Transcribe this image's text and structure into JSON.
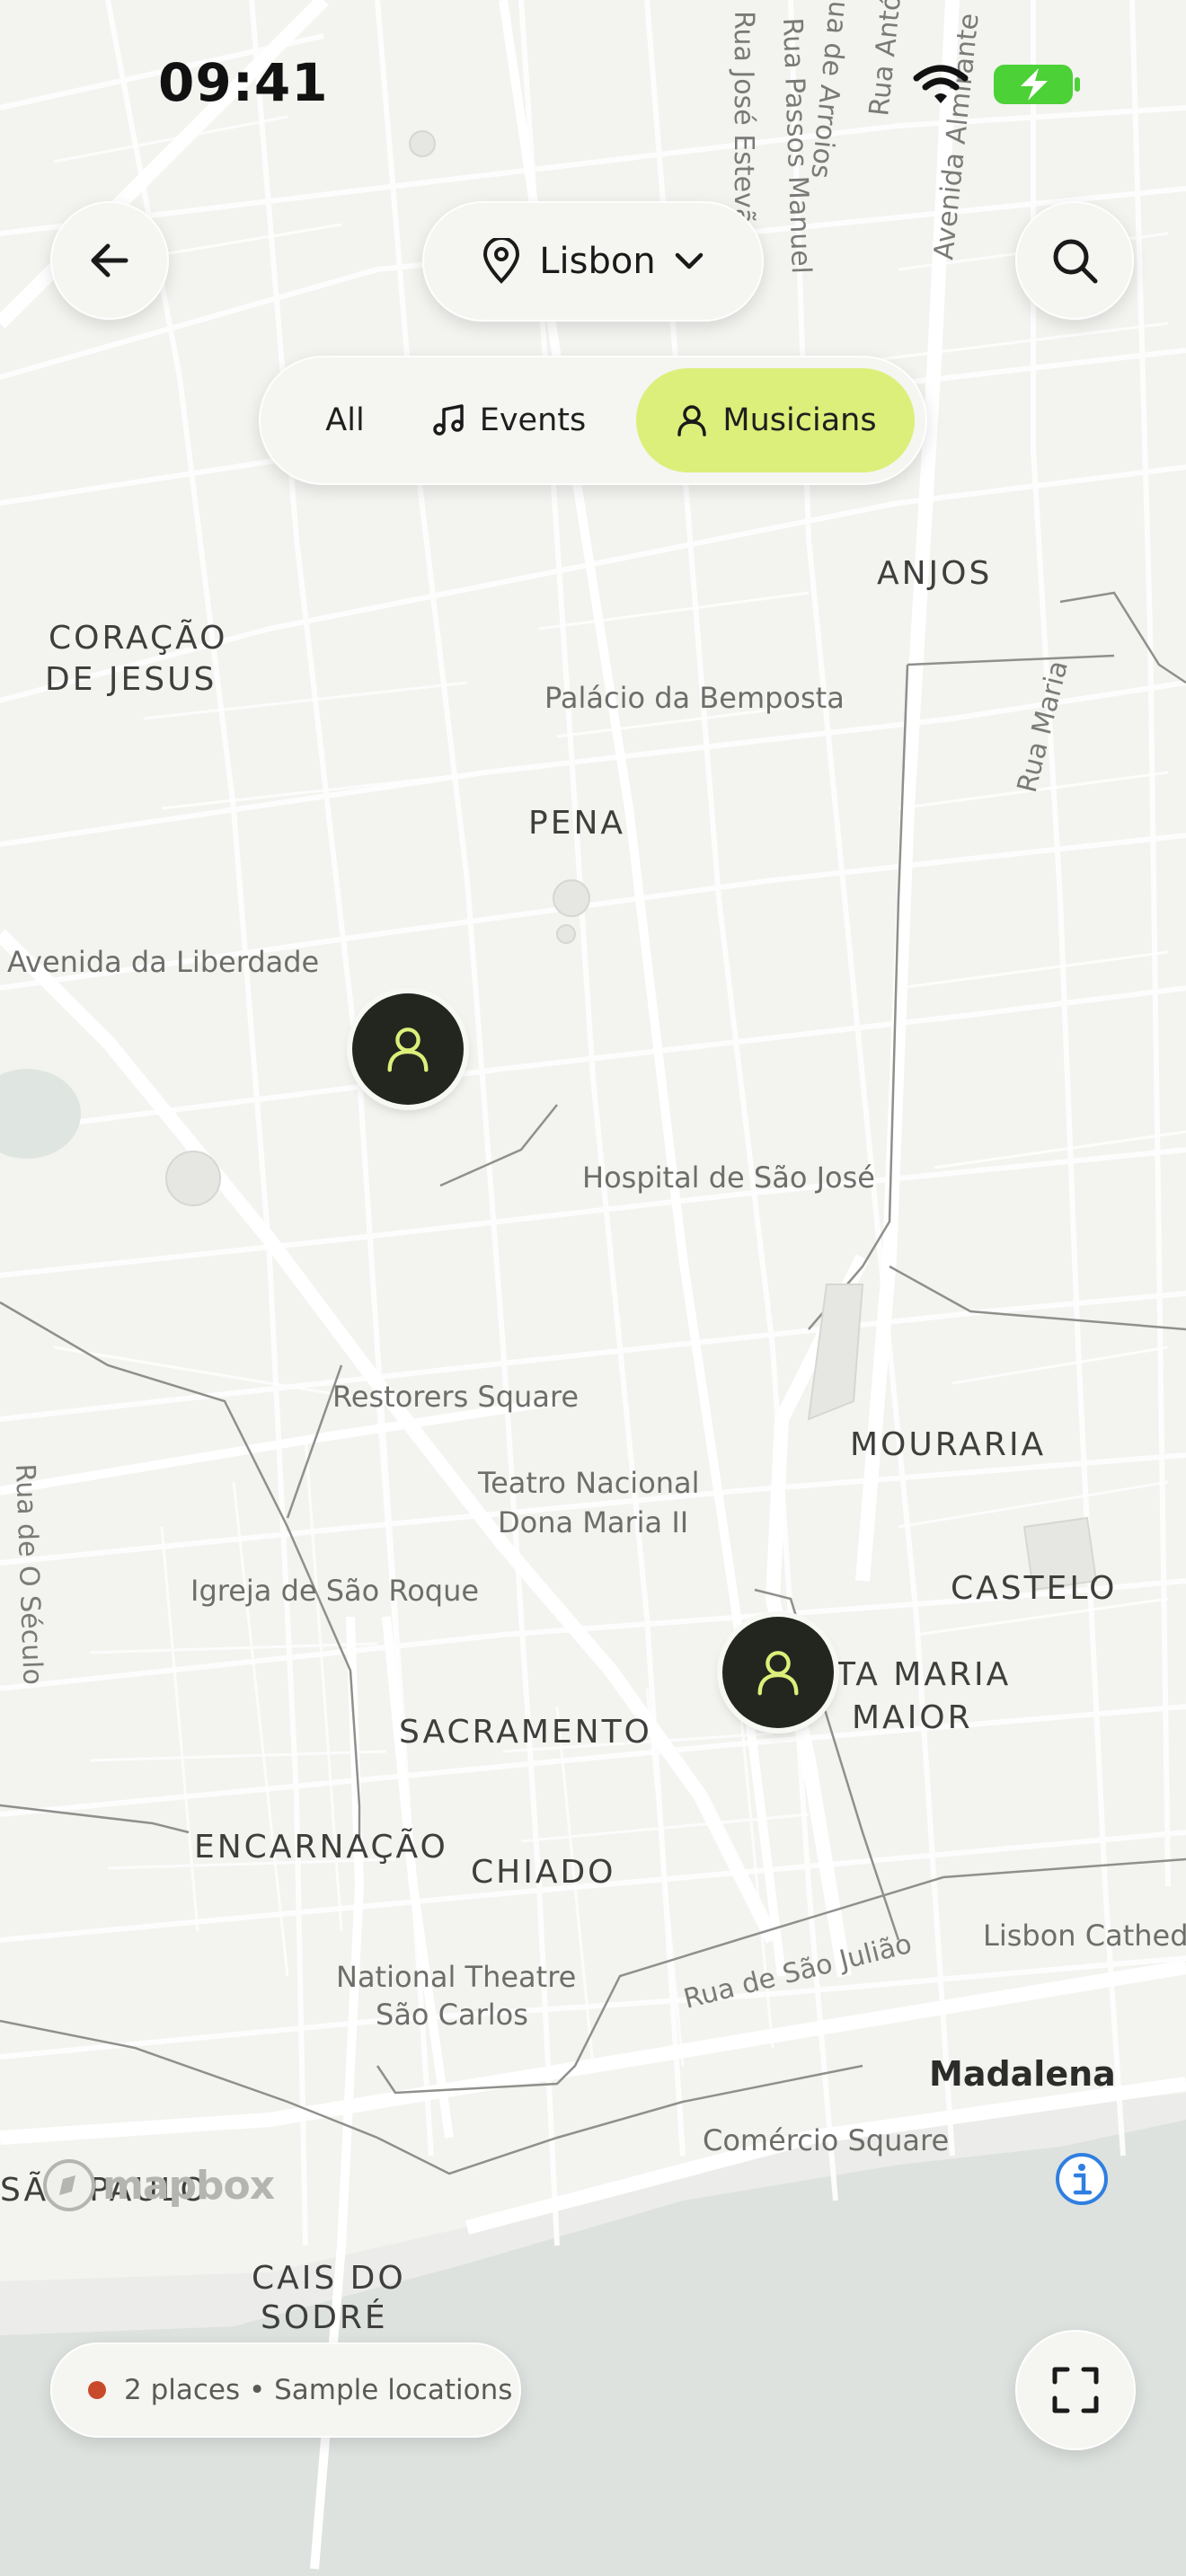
{
  "status_bar": {
    "time": "09:41"
  },
  "header": {
    "city": "Lisbon"
  },
  "filters": {
    "all": "All",
    "events": "Events",
    "musicians": "Musicians",
    "active": "Musicians"
  },
  "map": {
    "districts": [
      "ANJOS",
      "CORAÇÃO",
      "DE JESUS",
      "PENA",
      "MOURARIA",
      "CASTELO",
      "TA MARIA",
      "MAIOR",
      "SACRAMENTO",
      "ENCARNAÇÃO",
      "CHIADO",
      "CAIS DO",
      "SODRÉ",
      "SÃO PAULO",
      "Madalena"
    ],
    "places": [
      "Palácio da Bemposta",
      "Avenida da Liberdade",
      "Hospital de São José",
      "Restorers Square",
      "Teatro Nacional",
      "Dona Maria II",
      "Igreja de São Roque",
      "National Theatre",
      "São Carlos",
      "Lisbon Cathedr",
      "Comércio Square"
    ],
    "streets": [
      "Rua José Estevã",
      "Rua Passos Manuel",
      "ua de Arroios",
      "Rua Antó",
      "Avenida Almirante",
      "Rua Maria",
      "Rua de O Século",
      "Rua de São Julião"
    ],
    "attribution": "mapbox"
  },
  "footer": {
    "places_summary": "2 places • Sample locations"
  },
  "colors": {
    "accent": "#dcef7a",
    "pin": "#23261f",
    "dot": "#c84a2b",
    "info": "#2f7fe0",
    "battery": "#4cd137"
  }
}
